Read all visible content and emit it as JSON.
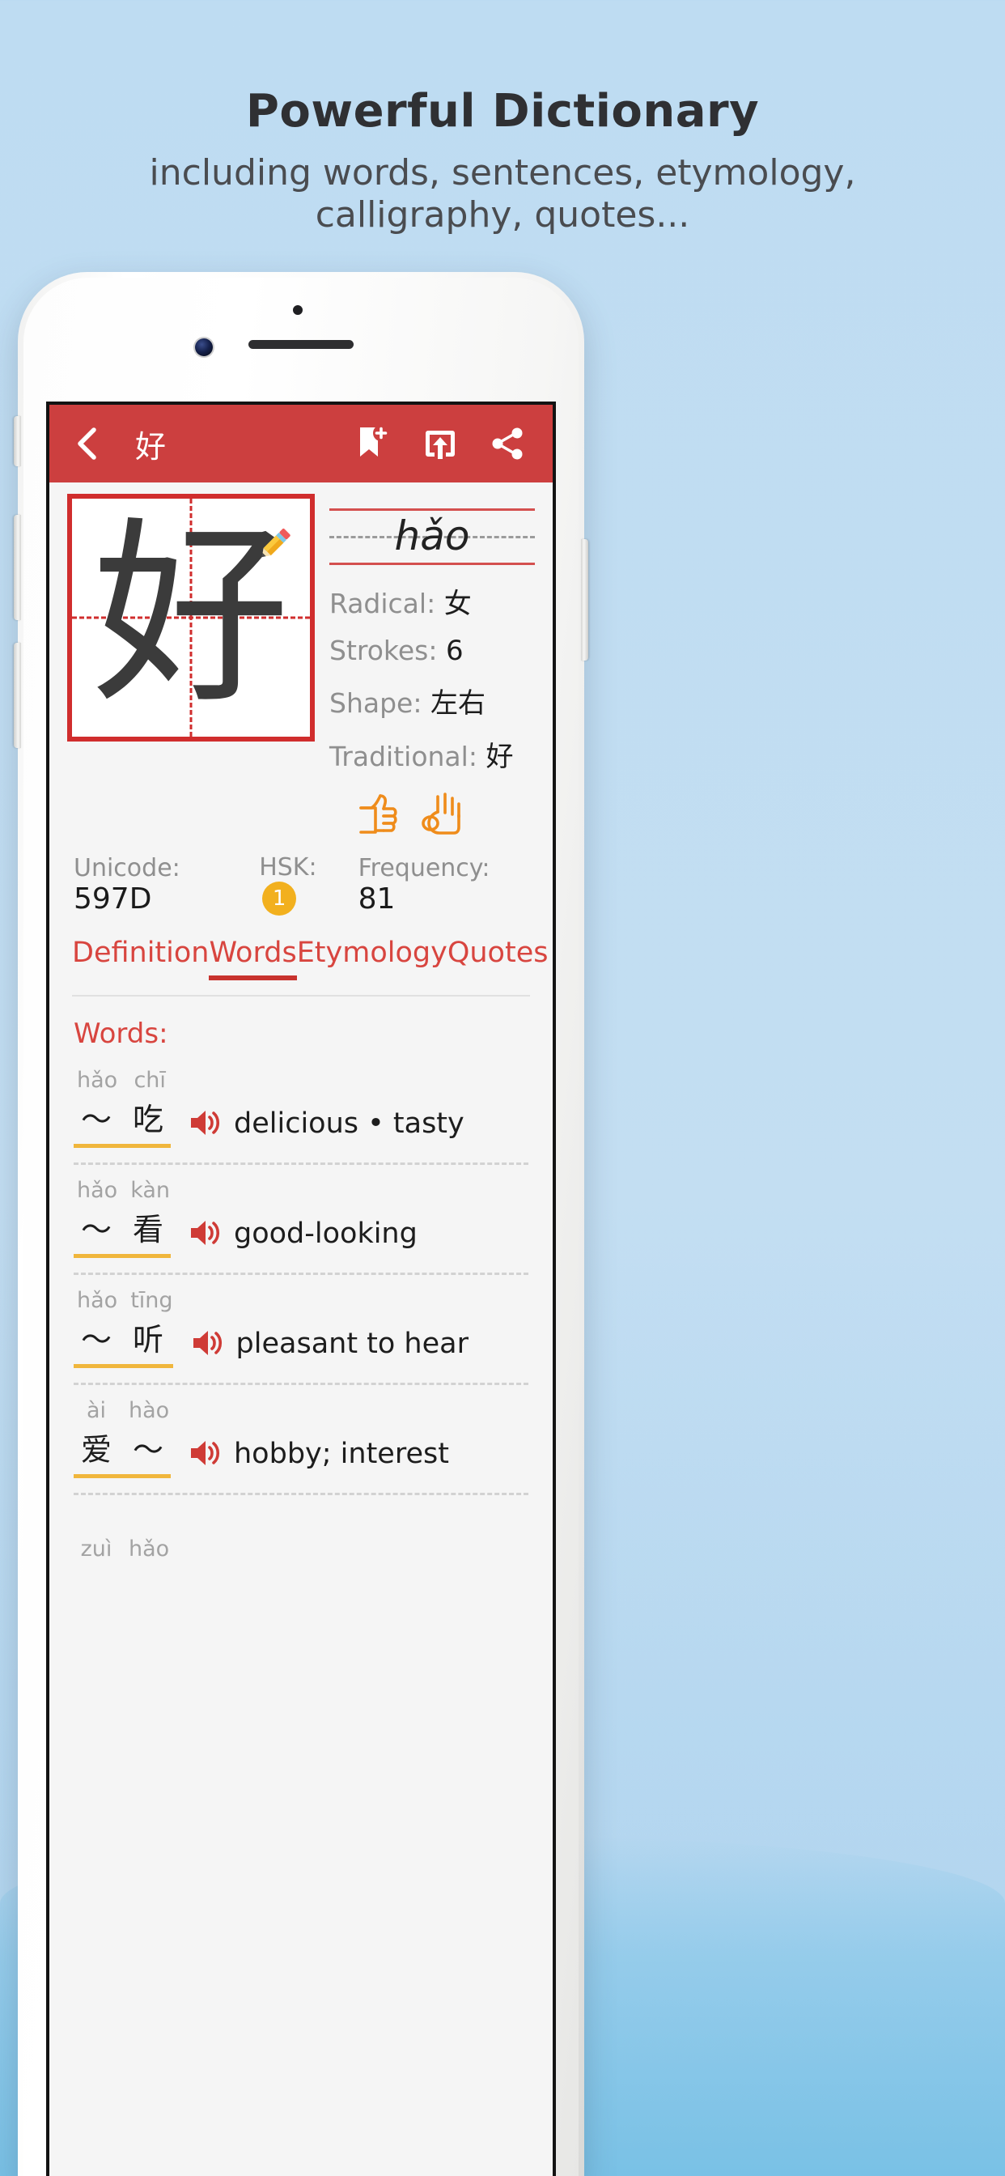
{
  "promo": {
    "title": "Powerful Dictionary",
    "subtitle": "including words, sentences, etymology, calligraphy, quotes..."
  },
  "colors": {
    "background": "#bedcf2",
    "appbar": "#cc3f3f",
    "accent_red": "#d8453f",
    "grid_red": "#d02d2d",
    "underline_orange": "#f0b63c",
    "hsk_badge": "#f2b01e"
  },
  "appbar": {
    "back_icon": "chevron-left-icon",
    "title": "好",
    "actions": [
      {
        "name": "bookmark-add-icon",
        "label": "Add bookmark"
      },
      {
        "name": "export-icon",
        "label": "Export"
      },
      {
        "name": "share-icon",
        "label": "Share"
      }
    ]
  },
  "character": {
    "glyph": "好",
    "pinyin": "hǎo",
    "edit_icon": "pencil-icon",
    "details": [
      {
        "label": "Radical:",
        "value": "女"
      },
      {
        "label": "Strokes:",
        "value": "6"
      },
      {
        "label": "Shape:",
        "value": "左右"
      },
      {
        "label": "Traditional:",
        "value": "好"
      }
    ],
    "gestures": [
      "thumbs-up-icon",
      "ok-hand-icon"
    ],
    "meta": {
      "unicode_label": "Unicode:",
      "unicode_value": "597D",
      "hsk_label": "HSK:",
      "hsk_value": "1",
      "frequency_label": "Frequency:",
      "frequency_value": "81"
    }
  },
  "tabs": [
    {
      "label": "Definition",
      "active": false
    },
    {
      "label": "Words",
      "active": true
    },
    {
      "label": "Etymology",
      "active": false
    },
    {
      "label": "Quotes",
      "active": false
    }
  ],
  "words_section": {
    "heading": "Words:",
    "items": [
      {
        "pinyin": [
          "hǎo",
          "chī"
        ],
        "hanzi": [
          "〜",
          "吃"
        ],
        "definition": "delicious • tasty",
        "audio_icon": "speaker-icon"
      },
      {
        "pinyin": [
          "hǎo",
          "kàn"
        ],
        "hanzi": [
          "〜",
          "看"
        ],
        "definition": "good-looking",
        "audio_icon": "speaker-icon"
      },
      {
        "pinyin": [
          "hǎo",
          "tīng"
        ],
        "hanzi": [
          "〜",
          "听"
        ],
        "definition": "pleasant to hear",
        "audio_icon": "speaker-icon"
      },
      {
        "pinyin": [
          "ài",
          "hào"
        ],
        "hanzi": [
          "爱",
          "〜"
        ],
        "definition": "hobby; interest",
        "audio_icon": "speaker-icon"
      },
      {
        "pinyin": [
          "zuì",
          "hǎo"
        ],
        "hanzi": [
          "",
          ""
        ],
        "definition": "",
        "audio_icon": "speaker-icon"
      }
    ]
  }
}
